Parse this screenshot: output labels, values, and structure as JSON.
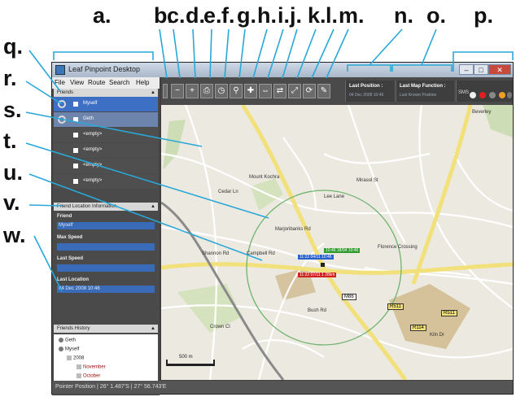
{
  "callouts": {
    "top": [
      "a.",
      "b.",
      "c.",
      "d.",
      "e.",
      "f.",
      "g.",
      "h.",
      "i.",
      "j.",
      "k.",
      "l.",
      "m.",
      "n.",
      "o.",
      "p."
    ],
    "left": [
      "q.",
      "r.",
      "s.",
      "t.",
      "u.",
      "v.",
      "w."
    ]
  },
  "window": {
    "title": "Leaf Pinpoint Desktop",
    "min": "–",
    "max": "□",
    "close": "✕"
  },
  "menu": [
    "File",
    "View",
    "Route",
    "Search",
    "Help"
  ],
  "friends_panel": {
    "header": "Friends",
    "rows": [
      "Myself",
      "Geth",
      "<empty>",
      "<empty>",
      "<empty>",
      "<empty>"
    ]
  },
  "location_panel": {
    "header": "Friend Location Information",
    "friend_label": "Friend",
    "friend_value": "Myself",
    "max_speed_label": "Max Speed",
    "max_speed_value": "",
    "last_speed_label": "Last Speed",
    "last_speed_value": "",
    "last_location_label": "Last Location",
    "last_location_value": "04 Dec 2008 10:46"
  },
  "history_panel": {
    "header": "Friends History",
    "tree": [
      "Geth",
      "Myself",
      "2008",
      "November",
      "October"
    ]
  },
  "toolbar": {
    "last_position_label": "Last Position :",
    "last_position_value": "04 Dec 2008 10:46",
    "last_map_function_label": "Last Map Function :",
    "last_map_function_value": "Last Known Position",
    "sms_label": "SMS"
  },
  "map": {
    "streets": [
      "Beverley",
      "Florence Crossing",
      "Marjoribanks Rd",
      "Campbell Rd",
      "Mount Kochra",
      "Cedar Ln",
      "Shannon Rd",
      "Mirasol St",
      "Lee Lane",
      "Crown Cl",
      "Kiln Dr",
      "Bush Rd"
    ],
    "route_labels": [
      "M86",
      "R511",
      "R511",
      "R114"
    ],
    "marker_green": "10:46 18/04 10:46",
    "marker_blue": "11:22 04/11 10:46",
    "marker_red": "11:22 07/11 1 28km",
    "scale": "500 m"
  },
  "status_bar": "Pointer Position | 26° 1.487'S | 27° 56.743'E"
}
